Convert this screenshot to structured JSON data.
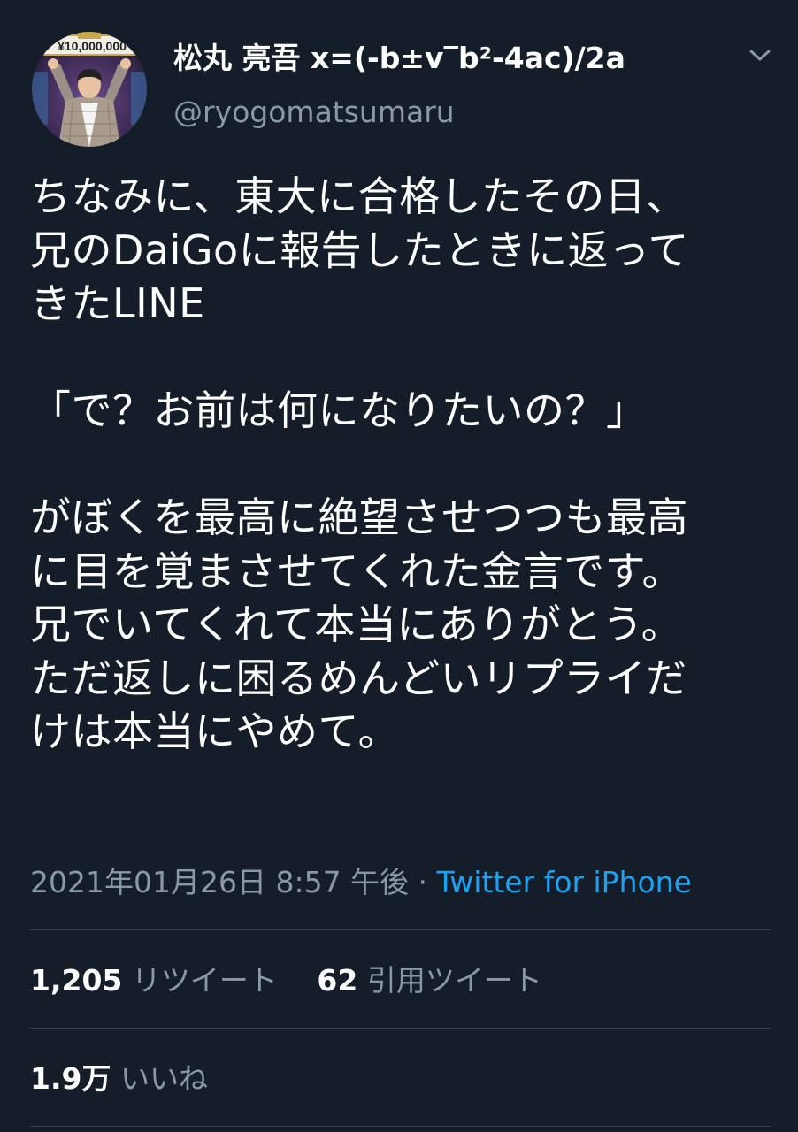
{
  "tweet": {
    "display_name": "松丸 亮吾 x=(-b±v‾b²-4ac)/2a",
    "handle": "@ryogomatsumaru",
    "avatar_sign_text": "¥10,000,000",
    "body_lines": [
      "ちなみに、東大に合格したその日、",
      "兄のDaiGoに報告したときに返って",
      "きたLINE",
      "",
      "「で？お前は何になりたいの？」",
      "",
      "がぼくを最高に絶望させつつも最高",
      "に目を覚まさせてくれた金言です。",
      "兄でいてくれて本当にありがとう。",
      "ただ返しに困るめんどいリプライだ",
      "けは本当にやめて。"
    ],
    "timestamp": "2021年01月26日 8:57 午後",
    "separator": " · ",
    "source": "Twitter for iPhone",
    "stats": {
      "retweets_count": "1,205",
      "retweets_label": "リツイート",
      "quotes_count": "62",
      "quotes_label": "引用ツイート",
      "likes_count": "1.9万",
      "likes_label": "いいね"
    }
  },
  "colors": {
    "background": "#151d28",
    "text": "#ffffff",
    "muted": "#8899a6",
    "link": "#1da1f2",
    "divider": "#38444d"
  },
  "icons": {
    "menu": "chevron-down-icon"
  }
}
